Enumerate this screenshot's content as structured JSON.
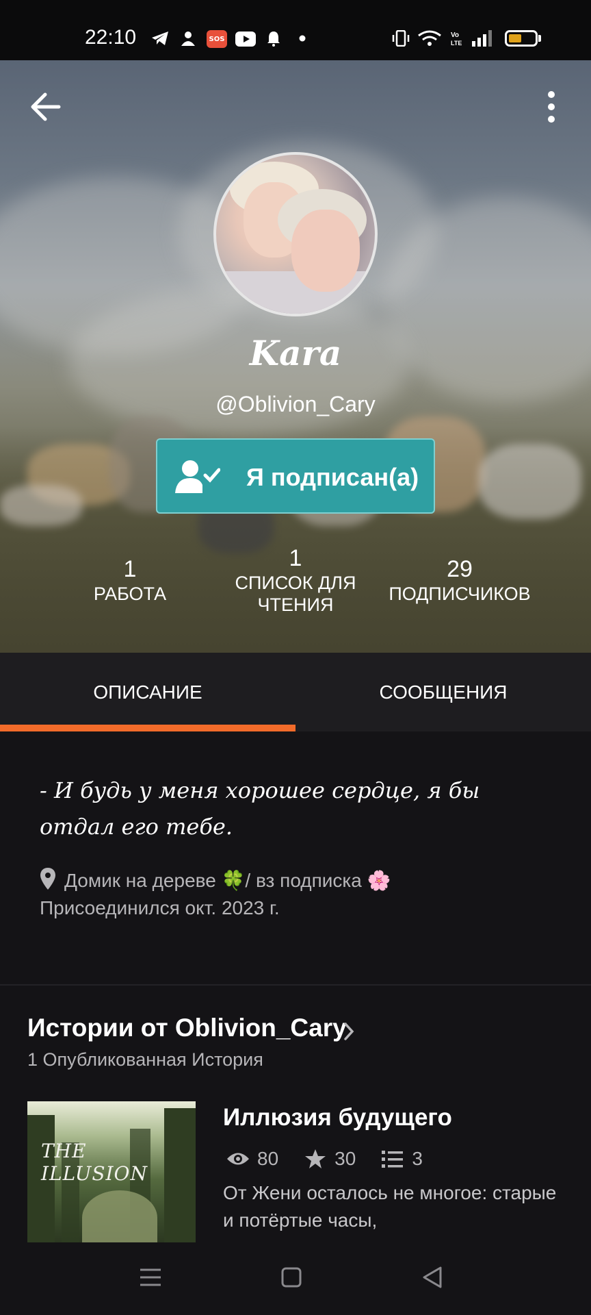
{
  "status_bar": {
    "time": "22:10",
    "icons": [
      "telegram-icon",
      "person-icon",
      "sos-icon",
      "youtube-icon",
      "bell-icon",
      "dot-icon",
      "vibrate-icon",
      "wifi-icon",
      "volte-icon",
      "signal-icon",
      "battery-icon"
    ],
    "sos_label": "SOS",
    "volte_label": "Vo\nLTE"
  },
  "profile": {
    "display_name": "Kara",
    "username": "@Oblivion_Cary",
    "follow_label": "Я подписан(а)",
    "stats": [
      {
        "value": "1",
        "label": "РАБОТА"
      },
      {
        "value": "1",
        "label": "СПИСОК ДЛЯ ЧТЕНИЯ"
      },
      {
        "value": "29",
        "label": "ПОДПИСЧИКОВ"
      }
    ]
  },
  "tabs": [
    {
      "label": "ОПИСАНИЕ",
      "active": true
    },
    {
      "label": "СООБЩЕНИЯ",
      "active": false
    }
  ],
  "about": {
    "bio": "- И будь у меня хорошее сердце, я бы отдал его тебе.",
    "location": "Домик на дереве 🍀/ вз подписка 🌸",
    "joined": "Присоединился окт. 2023 г."
  },
  "stories": {
    "title": "Истории от Oblivion_Cary",
    "subtitle": "1 Опубликованная История",
    "items": [
      {
        "title": "Иллюзия будущего",
        "cover_text": "THE ILLUSION",
        "views": "80",
        "votes": "30",
        "parts": "3",
        "description": "От Жени осталось не многое: старые и потёртые часы,"
      }
    ]
  },
  "colors": {
    "accent": "#f26b2a",
    "follow_button": "#2f9fa2",
    "background": "#141316",
    "tabs_background": "#1e1d20"
  }
}
